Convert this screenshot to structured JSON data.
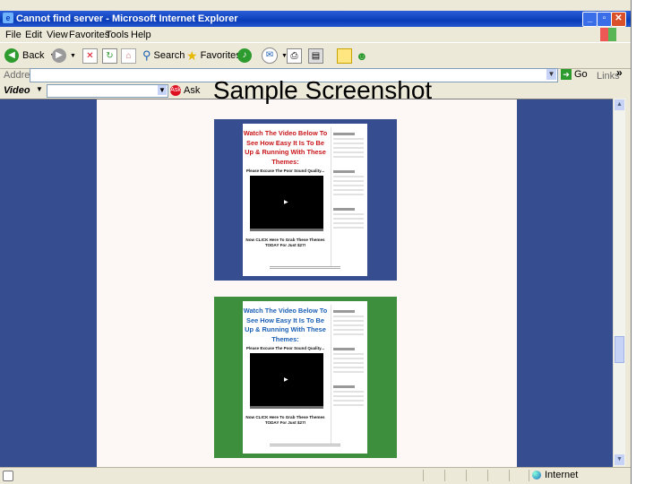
{
  "window": {
    "title": "Cannot find server - Microsoft Internet Explorer"
  },
  "menu": [
    "File",
    "Edit",
    "View",
    "Favorites",
    "Tools",
    "Help"
  ],
  "toolbar": {
    "back": "Back",
    "search": "Search",
    "favorites": "Favorites"
  },
  "address": {
    "label": "Address",
    "value": "",
    "go": "Go",
    "links": "Links",
    "chevron": "»"
  },
  "videobar": {
    "label": "Video",
    "ask": "Ask"
  },
  "overlay": {
    "text": "Sample Screenshot"
  },
  "status": {
    "zone": "Internet"
  },
  "thumbnails": [
    {
      "color": "#364d8f",
      "headline": "Watch The Video Below To See How Easy It Is To Be Up & Running With These Themes:",
      "subhead": "Please Excuse The Poor Sound Quality...",
      "cta": "Now CLICK Here To Grab These Themes TODAY For Just $27!"
    },
    {
      "color": "#3d8f3d",
      "headline": "Watch The Video Below To See How Easy It Is To Be Up & Running With These Themes:",
      "subhead": "Please Excuse The Poor Sound Quality...",
      "cta": "Now CLICK Here To Grab These Themes TODAY For Just $27!"
    }
  ]
}
